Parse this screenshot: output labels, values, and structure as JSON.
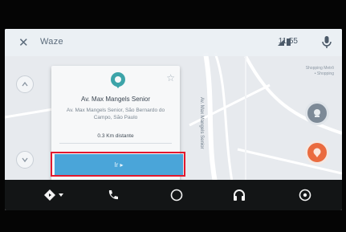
{
  "app": {
    "name": "Waze",
    "time": "11:55"
  },
  "map": {
    "corner_label": "Shopping Metrô\n• Shopping",
    "street_label": "Av. Max Mangels Senior"
  },
  "card": {
    "title": "Av. Max Mangels Senior",
    "address": "Av. Max Mangels Senior, São Bernardo do Campo, São Paulo",
    "distance": "0.3 Km distante",
    "go_label": "Ir ▸"
  },
  "colors": {
    "accent": "#4aa5d9",
    "highlight": "#e2192e",
    "orange": "#ea6b3f",
    "navbar": "#131516"
  },
  "bottom_nav": [
    {
      "name": "navigation-icon"
    },
    {
      "name": "phone-icon"
    },
    {
      "name": "home-icon"
    },
    {
      "name": "headphones-icon"
    },
    {
      "name": "power-icon"
    }
  ]
}
